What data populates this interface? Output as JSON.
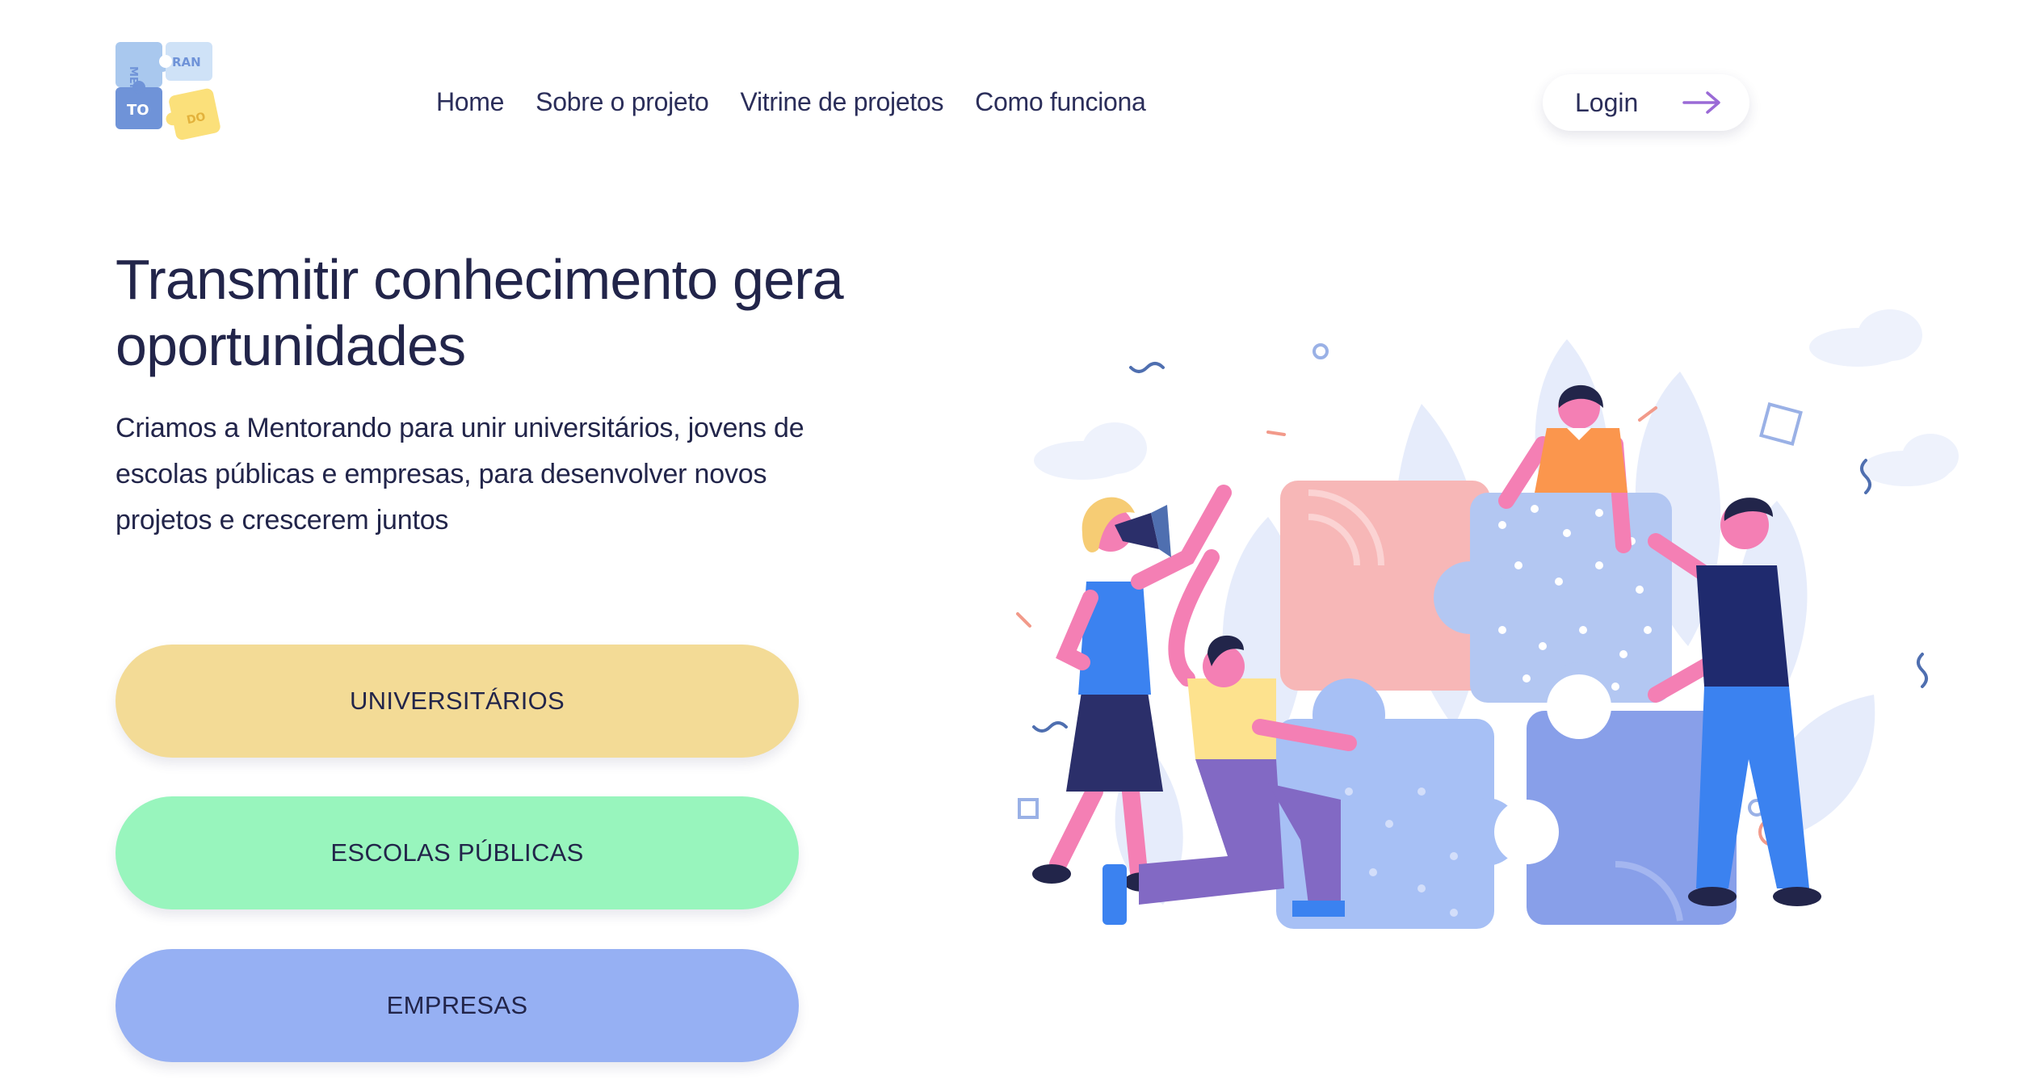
{
  "logo": {
    "pieces": [
      "MEN",
      "RAN",
      "TO",
      "DO"
    ]
  },
  "nav": {
    "items": [
      {
        "label": "Home"
      },
      {
        "label": "Sobre o projeto"
      },
      {
        "label": "Vitrine de projetos"
      },
      {
        "label": "Como funciona"
      }
    ]
  },
  "login": {
    "label": "Login",
    "icon": "arrow-right-icon"
  },
  "hero": {
    "title": "Transmitir conhecimento gera oportunidades",
    "text": "Criamos a Mentorando para unir universitários, jovens de escolas públicas e empresas, para desenvolver novos projetos e crescerem juntos"
  },
  "cta": {
    "universitarios": "UNIVERSITÁRIOS",
    "escolas": "ESCOLAS PÚBLICAS",
    "empresas": "EMPRESAS"
  },
  "colors": {
    "text": "#22254a",
    "yellow": "#f3db96",
    "green": "#98f5bd",
    "blue": "#96b0f3",
    "accent": "#9a6ad6"
  }
}
